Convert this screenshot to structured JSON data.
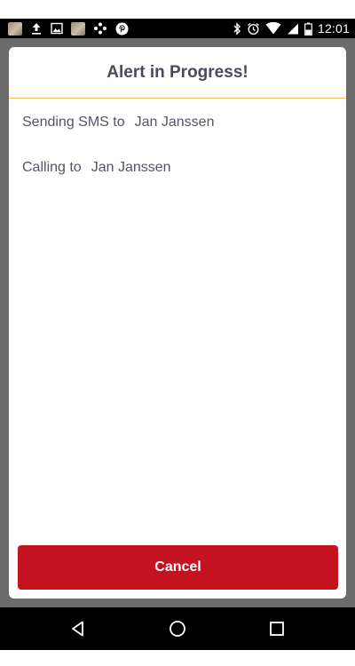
{
  "status_bar": {
    "time": "12:01",
    "left_icons": [
      "image-thumbnail-icon",
      "upload-icon",
      "picture-icon",
      "image-thumbnail-icon",
      "dots-icon",
      "pinterest-icon"
    ],
    "right_icons": [
      "bluetooth-icon",
      "alarm-icon",
      "wifi-icon",
      "signal-icon",
      "battery-icon"
    ]
  },
  "dialog": {
    "title": "Alert in Progress!",
    "lines": [
      {
        "action": "Sending SMS to",
        "contact": "Jan Janssen"
      },
      {
        "action": "Calling to",
        "contact": "Jan Janssen"
      }
    ],
    "cancel_label": "Cancel"
  },
  "colors": {
    "accent_red": "#c41220",
    "divider": "#f3c060",
    "title_text": "#4a4a5e",
    "backdrop": "#6b6b6b"
  },
  "nav_bar": {
    "buttons": [
      "back-icon",
      "home-icon",
      "recents-icon"
    ]
  }
}
